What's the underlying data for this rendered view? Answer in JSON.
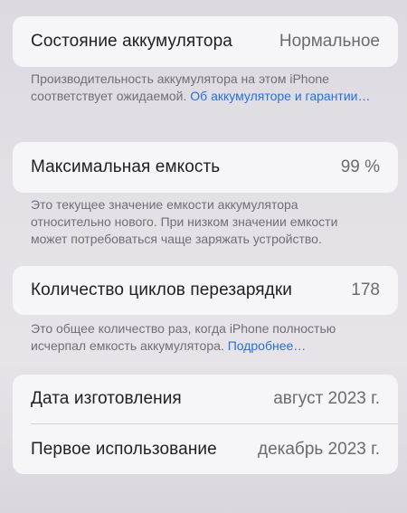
{
  "battery_state": {
    "label": "Состояние аккумулятора",
    "value": "Нормальное"
  },
  "performance_note": {
    "text": "Производительность аккумулятора на этом iPhone соответствует ожидаемой. ",
    "link": "Об аккумуляторе и гарантии…"
  },
  "max_capacity": {
    "label": "Максимальная емкость",
    "value": "99 %"
  },
  "capacity_note": {
    "text": "Это текущее значение емкости аккумулятора относительно нового. При низком значении емкости может потребоваться чаще заряжать устройство."
  },
  "cycle_count": {
    "label": "Количество циклов перезарядки",
    "value": "178"
  },
  "cycle_note": {
    "text": "Это общее количество раз, когда iPhone полностью исчерпал емкость аккумулятора. ",
    "link": "Подробнее…"
  },
  "manufacture_date": {
    "label": "Дата изготовления",
    "value": "август 2023 г."
  },
  "first_use": {
    "label": "Первое использование",
    "value": "декабрь 2023 г."
  },
  "colors": {
    "background": "#e3e1e6",
    "card": "#f6f5f8",
    "link": "#2a6fd6",
    "secondary_text": "#716f76"
  }
}
